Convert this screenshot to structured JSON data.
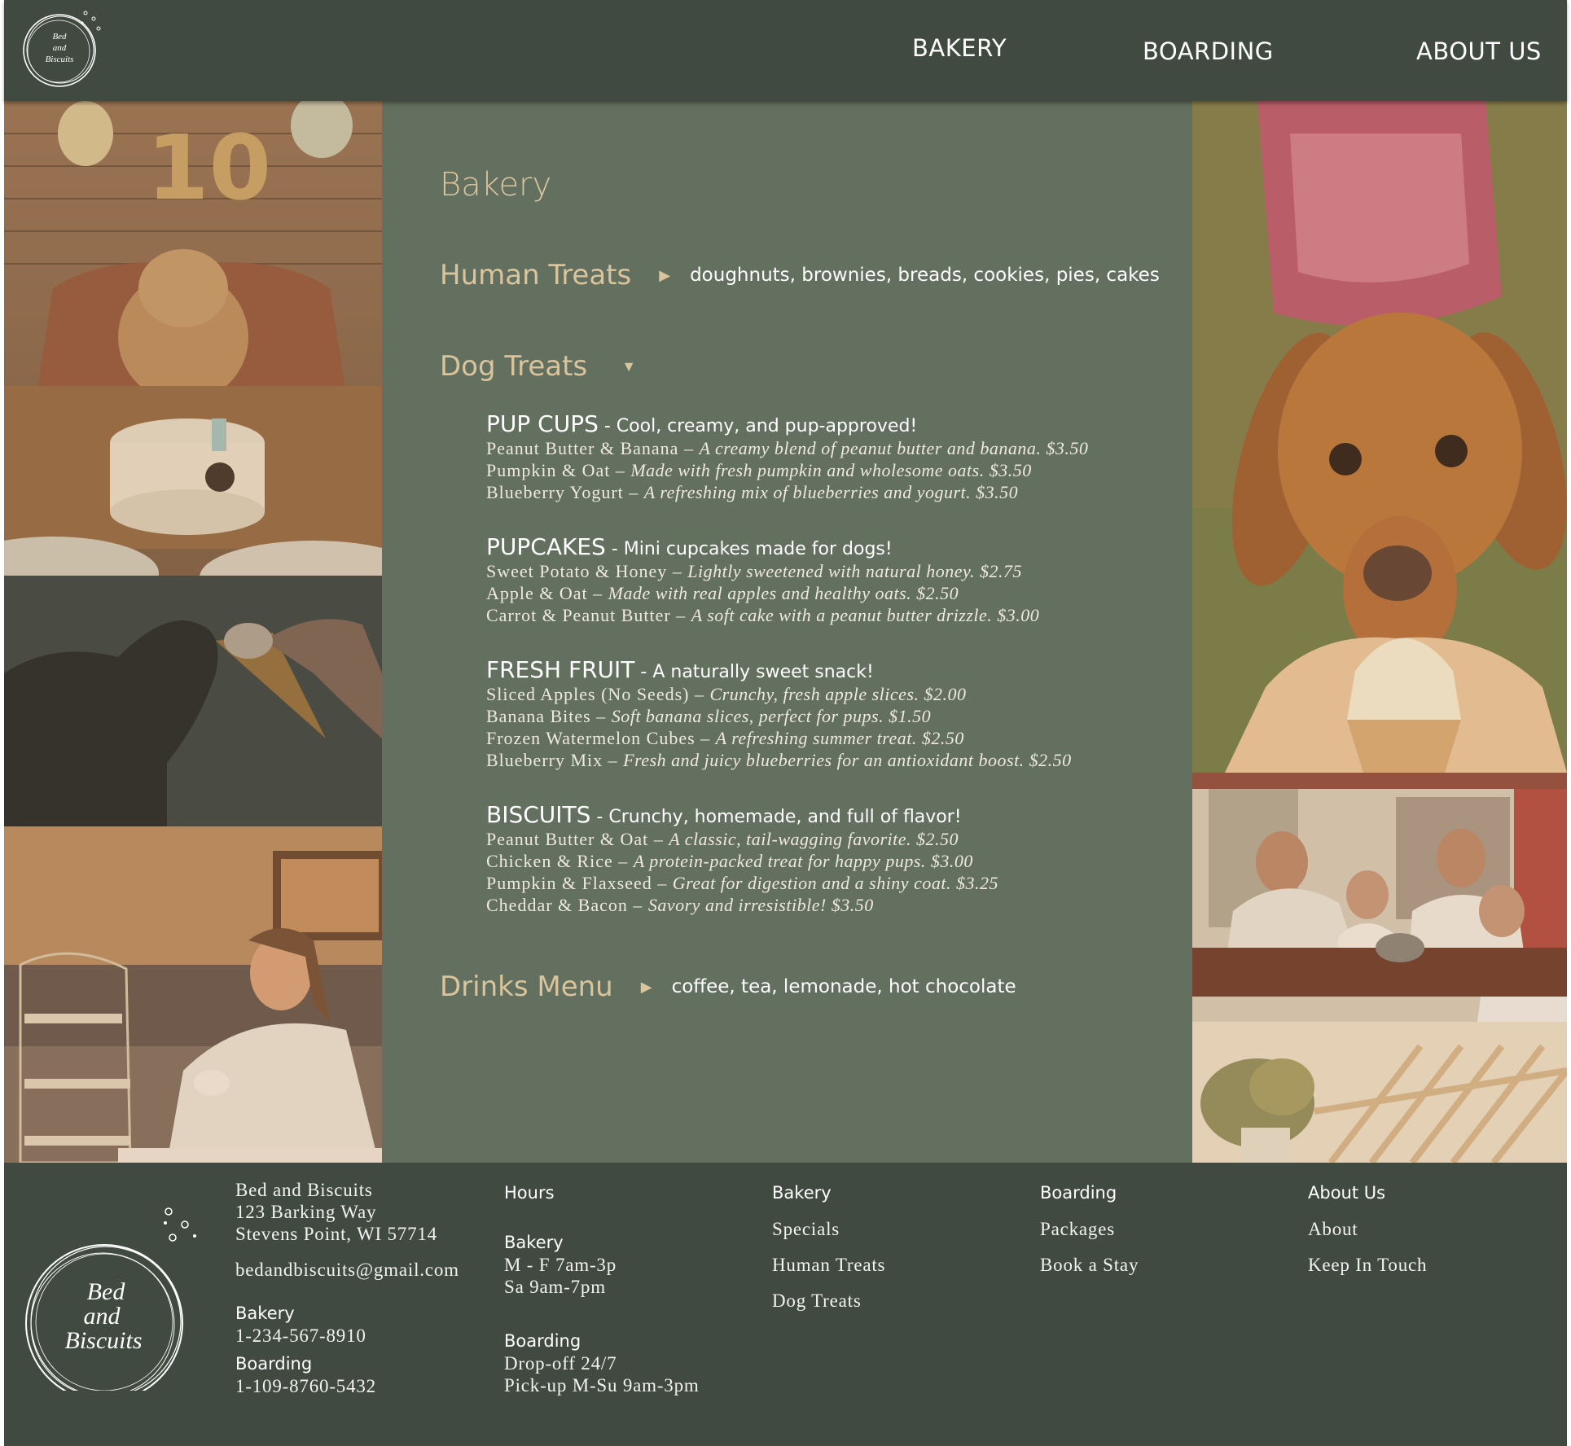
{
  "brand": {
    "logo_text": [
      "Bed",
      "and",
      "Biscuits"
    ]
  },
  "nav": {
    "bakery": "BAKERY",
    "boarding": "BOARDING",
    "about": "ABOUT US"
  },
  "menu": {
    "title": "Bakery",
    "human_treats": {
      "label": "Human Treats",
      "summary": "doughnuts, brownies, breads, cookies, pies, cakes"
    },
    "dog_treats": {
      "label": "Dog Treats"
    },
    "sections": [
      {
        "name": "PUP CUPS",
        "tagline": " - Cool, creamy, and pup-approved!",
        "items": [
          {
            "name": "Peanut Butter & Banana – ",
            "desc": "A creamy blend of peanut butter and banana. $3.50"
          },
          {
            "name": "Pumpkin & Oat – ",
            "desc": "Made with fresh pumpkin and wholesome oats. $3.50"
          },
          {
            "name": "Blueberry Yogurt – ",
            "desc": "A refreshing mix of blueberries and yogurt. $3.50"
          }
        ]
      },
      {
        "name": "PUPCAKES",
        "tagline": " - Mini cupcakes made for dogs!",
        "items": [
          {
            "name": "Sweet Potato & Honey – ",
            "desc": "Lightly sweetened with natural honey. $2.75"
          },
          {
            "name": "Apple & Oat – ",
            "desc": "Made with real apples and healthy oats. $2.50"
          },
          {
            "name": "Carrot & Peanut Butter – ",
            "desc": "A soft cake with a peanut butter drizzle. $3.00"
          }
        ]
      },
      {
        "name": "FRESH FRUIT",
        "tagline": " - A naturally sweet snack!",
        "items": [
          {
            "name": "Sliced Apples (No Seeds) – ",
            "desc": "Crunchy, fresh apple slices. $2.00"
          },
          {
            "name": "Banana Bites – ",
            "desc": "Soft banana slices, perfect for pups. $1.50"
          },
          {
            "name": "Frozen Watermelon Cubes – ",
            "desc": "A refreshing summer treat. $2.50"
          },
          {
            "name": "Blueberry Mix – ",
            "desc": "Fresh and juicy blueberries for an antioxidant boost. $2.50"
          }
        ]
      },
      {
        "name": "BISCUITS",
        "tagline": " - Crunchy, homemade, and full of flavor!",
        "items": [
          {
            "name": "Peanut Butter & Oat – ",
            "desc": "A classic, tail-wagging favorite. $2.50"
          },
          {
            "name": "Chicken & Rice – ",
            "desc": "A protein-packed treat for happy pups. $3.00"
          },
          {
            "name": "Pumpkin & Flaxseed – ",
            "desc": "Great for digestion and a shiny coat. $3.25"
          },
          {
            "name": "Cheddar & Bacon – ",
            "desc": "Savory and irresistible! $3.50"
          }
        ]
      }
    ],
    "drinks": {
      "label": "Drinks Menu",
      "summary": "coffee, tea, lemonade, hot chocolate"
    }
  },
  "footer": {
    "address": [
      "Bed and Biscuits",
      "123 Barking Way",
      "Stevens Point, WI 57714"
    ],
    "email": "bedandbiscuits@gmail.com",
    "phone_bakery_label": "Bakery",
    "phone_bakery": "1-234-567-8910",
    "phone_boarding_label": "Boarding",
    "phone_boarding": "1-109-8760-5432",
    "hours": {
      "title": "Hours",
      "bakery_label": "Bakery",
      "bakery_lines": [
        "M - F 7am-3p",
        "Sa 9am-7pm"
      ],
      "boarding_label": "Boarding",
      "boarding_lines": [
        "Drop-off 24/7",
        "Pick-up M-Su 9am-3pm"
      ]
    },
    "bakery_col": {
      "title": "Bakery",
      "links": [
        "Specials",
        "Human Treats",
        "Dog Treats"
      ]
    },
    "boarding_col": {
      "title": "Boarding",
      "links": [
        "Packages",
        "Book a Stay"
      ]
    },
    "about_col": {
      "title": "About Us",
      "links": [
        "About",
        "Keep In Touch"
      ]
    }
  },
  "colors": {
    "header_bg": "#414a41",
    "panel_bg": "#636f5f",
    "accent_gold": "#d9c49c"
  }
}
